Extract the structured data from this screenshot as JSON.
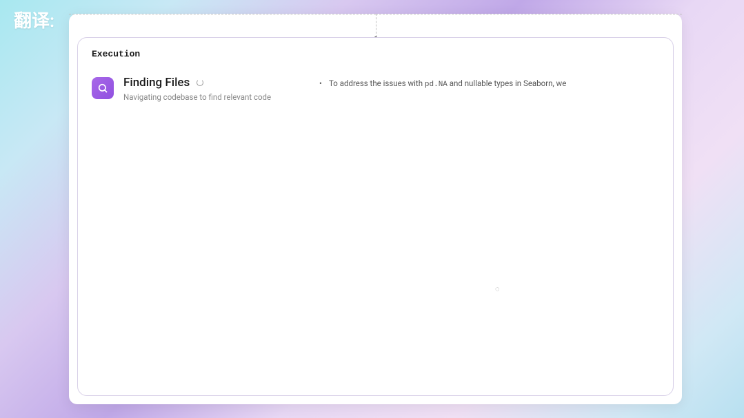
{
  "topLabel": "翻译:",
  "panel": {
    "header": "Execution",
    "icon": "search-icon",
    "title": "Finding Files",
    "subtitle": "Navigating codebase to find relevant code",
    "status": "loading"
  },
  "output": {
    "bullets": [
      {
        "prefix": "To address the issues with ",
        "code": "pd.NA",
        "suffix": " and nullable types in Seaborn, we"
      }
    ]
  },
  "spinnerGlyph": "◌"
}
